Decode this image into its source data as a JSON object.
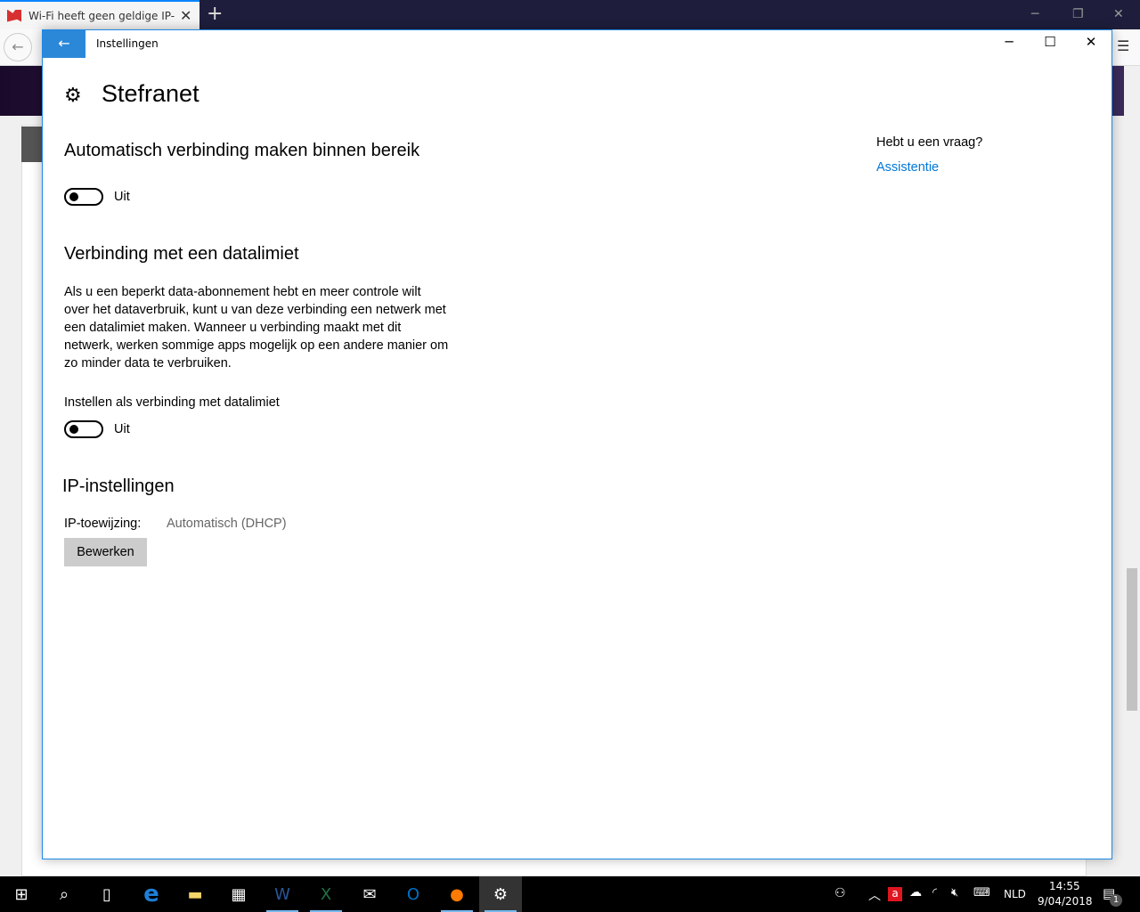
{
  "browser": {
    "tab_title": "Wi-Fi heeft geen geldige IP-configuratie",
    "new_tab": "+",
    "close": "✕"
  },
  "window": {
    "title": "Instellingen",
    "back": "←",
    "minimize": "─",
    "maximize": "☐",
    "close": "✕"
  },
  "page": {
    "title": "Stefranet",
    "auto_connect": {
      "heading": "Automatisch verbinding maken binnen bereik",
      "state": "Uit",
      "on": false
    },
    "metered": {
      "heading": "Verbinding met een datalimiet",
      "description": [
        "Als u een beperkt data-abonnement hebt en meer controle wilt",
        "over het dataverbruik, kunt u van deze verbinding een netwerk met",
        "een datalimiet maken. Wanneer u verbinding maakt met dit",
        "netwerk, werken sommige apps mogelijk op een andere manier om",
        "zo minder data te verbruiken."
      ],
      "toggle_label": "Instellen als verbinding met datalimiet",
      "state": "Uit",
      "on": false
    },
    "ip": {
      "heading": "IP-instellingen",
      "assignment_label": "IP-toewijzing:",
      "assignment_value": "Automatisch (DHCP)",
      "edit_button": "Bewerken"
    },
    "help": {
      "question": "Hebt u een vraag?",
      "link": "Assistentie"
    }
  },
  "taskbar": {
    "time": "14:55",
    "date": "9/04/2018",
    "language": "NLD",
    "notifications": "1"
  },
  "colors": {
    "accent": "#2b88d8",
    "link": "#0078d7"
  }
}
